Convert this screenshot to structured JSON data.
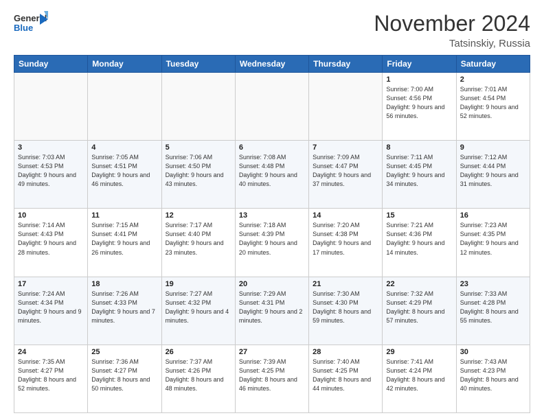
{
  "logo": {
    "line1": "General",
    "line2": "Blue"
  },
  "title": "November 2024",
  "location": "Tatsinskiy, Russia",
  "days_of_week": [
    "Sunday",
    "Monday",
    "Tuesday",
    "Wednesday",
    "Thursday",
    "Friday",
    "Saturday"
  ],
  "weeks": [
    [
      {
        "day": "",
        "info": ""
      },
      {
        "day": "",
        "info": ""
      },
      {
        "day": "",
        "info": ""
      },
      {
        "day": "",
        "info": ""
      },
      {
        "day": "",
        "info": ""
      },
      {
        "day": "1",
        "info": "Sunrise: 7:00 AM\nSunset: 4:56 PM\nDaylight: 9 hours and 56 minutes."
      },
      {
        "day": "2",
        "info": "Sunrise: 7:01 AM\nSunset: 4:54 PM\nDaylight: 9 hours and 52 minutes."
      }
    ],
    [
      {
        "day": "3",
        "info": "Sunrise: 7:03 AM\nSunset: 4:53 PM\nDaylight: 9 hours and 49 minutes."
      },
      {
        "day": "4",
        "info": "Sunrise: 7:05 AM\nSunset: 4:51 PM\nDaylight: 9 hours and 46 minutes."
      },
      {
        "day": "5",
        "info": "Sunrise: 7:06 AM\nSunset: 4:50 PM\nDaylight: 9 hours and 43 minutes."
      },
      {
        "day": "6",
        "info": "Sunrise: 7:08 AM\nSunset: 4:48 PM\nDaylight: 9 hours and 40 minutes."
      },
      {
        "day": "7",
        "info": "Sunrise: 7:09 AM\nSunset: 4:47 PM\nDaylight: 9 hours and 37 minutes."
      },
      {
        "day": "8",
        "info": "Sunrise: 7:11 AM\nSunset: 4:45 PM\nDaylight: 9 hours and 34 minutes."
      },
      {
        "day": "9",
        "info": "Sunrise: 7:12 AM\nSunset: 4:44 PM\nDaylight: 9 hours and 31 minutes."
      }
    ],
    [
      {
        "day": "10",
        "info": "Sunrise: 7:14 AM\nSunset: 4:43 PM\nDaylight: 9 hours and 28 minutes."
      },
      {
        "day": "11",
        "info": "Sunrise: 7:15 AM\nSunset: 4:41 PM\nDaylight: 9 hours and 26 minutes."
      },
      {
        "day": "12",
        "info": "Sunrise: 7:17 AM\nSunset: 4:40 PM\nDaylight: 9 hours and 23 minutes."
      },
      {
        "day": "13",
        "info": "Sunrise: 7:18 AM\nSunset: 4:39 PM\nDaylight: 9 hours and 20 minutes."
      },
      {
        "day": "14",
        "info": "Sunrise: 7:20 AM\nSunset: 4:38 PM\nDaylight: 9 hours and 17 minutes."
      },
      {
        "day": "15",
        "info": "Sunrise: 7:21 AM\nSunset: 4:36 PM\nDaylight: 9 hours and 14 minutes."
      },
      {
        "day": "16",
        "info": "Sunrise: 7:23 AM\nSunset: 4:35 PM\nDaylight: 9 hours and 12 minutes."
      }
    ],
    [
      {
        "day": "17",
        "info": "Sunrise: 7:24 AM\nSunset: 4:34 PM\nDaylight: 9 hours and 9 minutes."
      },
      {
        "day": "18",
        "info": "Sunrise: 7:26 AM\nSunset: 4:33 PM\nDaylight: 9 hours and 7 minutes."
      },
      {
        "day": "19",
        "info": "Sunrise: 7:27 AM\nSunset: 4:32 PM\nDaylight: 9 hours and 4 minutes."
      },
      {
        "day": "20",
        "info": "Sunrise: 7:29 AM\nSunset: 4:31 PM\nDaylight: 9 hours and 2 minutes."
      },
      {
        "day": "21",
        "info": "Sunrise: 7:30 AM\nSunset: 4:30 PM\nDaylight: 8 hours and 59 minutes."
      },
      {
        "day": "22",
        "info": "Sunrise: 7:32 AM\nSunset: 4:29 PM\nDaylight: 8 hours and 57 minutes."
      },
      {
        "day": "23",
        "info": "Sunrise: 7:33 AM\nSunset: 4:28 PM\nDaylight: 8 hours and 55 minutes."
      }
    ],
    [
      {
        "day": "24",
        "info": "Sunrise: 7:35 AM\nSunset: 4:27 PM\nDaylight: 8 hours and 52 minutes."
      },
      {
        "day": "25",
        "info": "Sunrise: 7:36 AM\nSunset: 4:27 PM\nDaylight: 8 hours and 50 minutes."
      },
      {
        "day": "26",
        "info": "Sunrise: 7:37 AM\nSunset: 4:26 PM\nDaylight: 8 hours and 48 minutes."
      },
      {
        "day": "27",
        "info": "Sunrise: 7:39 AM\nSunset: 4:25 PM\nDaylight: 8 hours and 46 minutes."
      },
      {
        "day": "28",
        "info": "Sunrise: 7:40 AM\nSunset: 4:25 PM\nDaylight: 8 hours and 44 minutes."
      },
      {
        "day": "29",
        "info": "Sunrise: 7:41 AM\nSunset: 4:24 PM\nDaylight: 8 hours and 42 minutes."
      },
      {
        "day": "30",
        "info": "Sunrise: 7:43 AM\nSunset: 4:23 PM\nDaylight: 8 hours and 40 minutes."
      }
    ]
  ]
}
